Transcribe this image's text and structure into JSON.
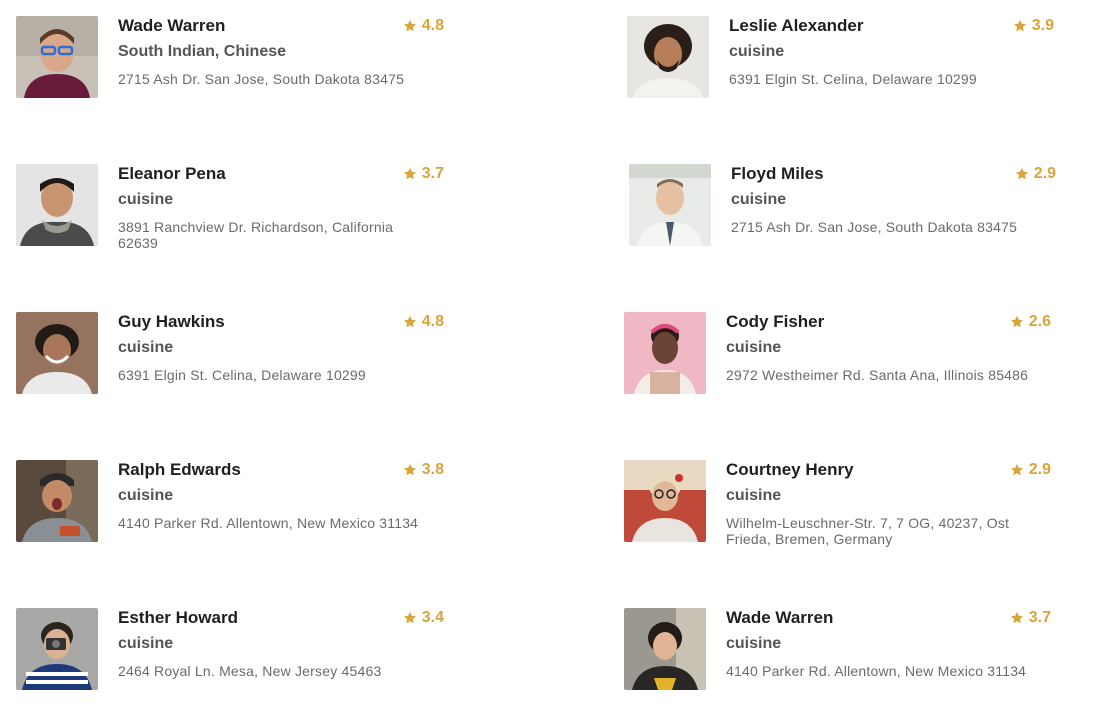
{
  "accent_color": "#d9a43a",
  "rating_icon": "star-icon",
  "people": [
    {
      "name": "Wade Warren",
      "cuisine": "South Indian, Chinese",
      "address": "2715 Ash Dr. San Jose, South Dakota 83475",
      "rating": "4.8"
    },
    {
      "name": "Leslie Alexander",
      "cuisine": "cuisine",
      "address": "6391 Elgin St. Celina, Delaware 10299",
      "rating": "3.9"
    },
    {
      "name": "Eleanor Pena",
      "cuisine": "cuisine",
      "address": "3891 Ranchview Dr. Richardson, California 62639",
      "rating": "3.7"
    },
    {
      "name": "Floyd Miles",
      "cuisine": "cuisine",
      "address": "2715 Ash Dr. San Jose, South Dakota 83475",
      "rating": "2.9"
    },
    {
      "name": "Guy Hawkins",
      "cuisine": "cuisine",
      "address": "6391 Elgin St. Celina, Delaware 10299",
      "rating": "4.8"
    },
    {
      "name": "Cody Fisher",
      "cuisine": "cuisine",
      "address": "2972 Westheimer Rd. Santa Ana, Illinois 85486",
      "rating": "2.6"
    },
    {
      "name": "Ralph Edwards",
      "cuisine": "cuisine",
      "address": "4140 Parker Rd. Allentown, New Mexico 31134",
      "rating": "3.8"
    },
    {
      "name": "Courtney Henry",
      "cuisine": "cuisine",
      "address": "Wilhelm-Leuschner-Str. 7, 7 OG, 40237, Ost Frieda, Bremen, Germany",
      "rating": "2.9"
    },
    {
      "name": "Esther Howard",
      "cuisine": "cuisine",
      "address": "2464 Royal Ln. Mesa, New Jersey 45463",
      "rating": "3.4"
    },
    {
      "name": "Wade Warren",
      "cuisine": "cuisine",
      "address": "4140 Parker Rd. Allentown, New Mexico 31134",
      "rating": "3.7"
    }
  ]
}
